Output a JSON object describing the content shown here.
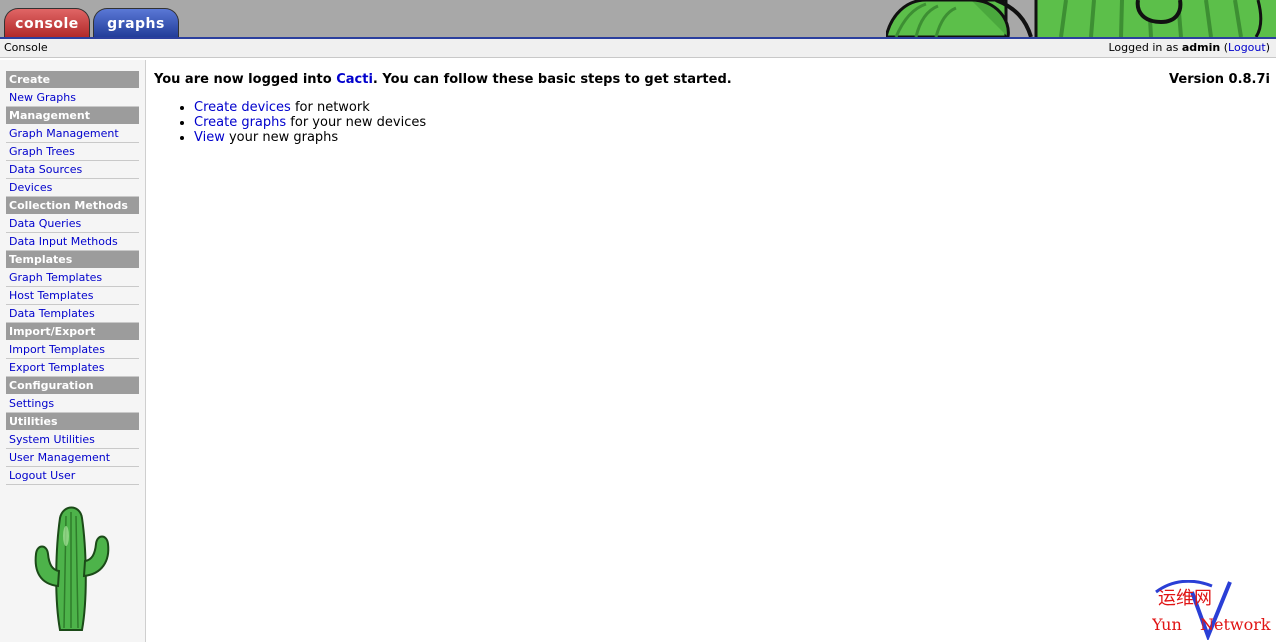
{
  "tabs": {
    "console": "console",
    "graphs": "graphs"
  },
  "breadcrumb": "Console",
  "login": {
    "prefix": "Logged in as",
    "user": "admin",
    "open": "(",
    "logout": "Logout",
    "close": ")"
  },
  "menu": [
    {
      "type": "head",
      "label": "Create"
    },
    {
      "type": "item",
      "label": "New Graphs"
    },
    {
      "type": "head",
      "label": "Management"
    },
    {
      "type": "item",
      "label": "Graph Management"
    },
    {
      "type": "item",
      "label": "Graph Trees"
    },
    {
      "type": "item",
      "label": "Data Sources"
    },
    {
      "type": "item",
      "label": "Devices"
    },
    {
      "type": "head",
      "label": "Collection Methods"
    },
    {
      "type": "item",
      "label": "Data Queries"
    },
    {
      "type": "item",
      "label": "Data Input Methods"
    },
    {
      "type": "head",
      "label": "Templates"
    },
    {
      "type": "item",
      "label": "Graph Templates"
    },
    {
      "type": "item",
      "label": "Host Templates"
    },
    {
      "type": "item",
      "label": "Data Templates"
    },
    {
      "type": "head",
      "label": "Import/Export"
    },
    {
      "type": "item",
      "label": "Import Templates"
    },
    {
      "type": "item",
      "label": "Export Templates"
    },
    {
      "type": "head",
      "label": "Configuration"
    },
    {
      "type": "item",
      "label": "Settings"
    },
    {
      "type": "head",
      "label": "Utilities"
    },
    {
      "type": "item",
      "label": "System Utilities"
    },
    {
      "type": "item",
      "label": "User Management"
    },
    {
      "type": "item",
      "label": "Logout User"
    }
  ],
  "main": {
    "welcome_pre": "You are now logged into",
    "welcome_link": "Cacti",
    "welcome_post": ". You can follow these basic steps to get started.",
    "version": "Version 0.8.7i",
    "steps": [
      {
        "link": "Create devices",
        "text": " for network"
      },
      {
        "link": "Create graphs",
        "text": " for your new devices"
      },
      {
        "link": "View",
        "text": " your new graphs"
      }
    ]
  },
  "watermark": {
    "cn": "运维网",
    "en_left": "Yun",
    "en_right": "Network"
  },
  "colors": {
    "link": "#0000cc",
    "menu_head": "#9c9c9c",
    "tab_console": "#c83a3a",
    "tab_graphs": "#3350b5",
    "cactus": "#4db34a"
  }
}
